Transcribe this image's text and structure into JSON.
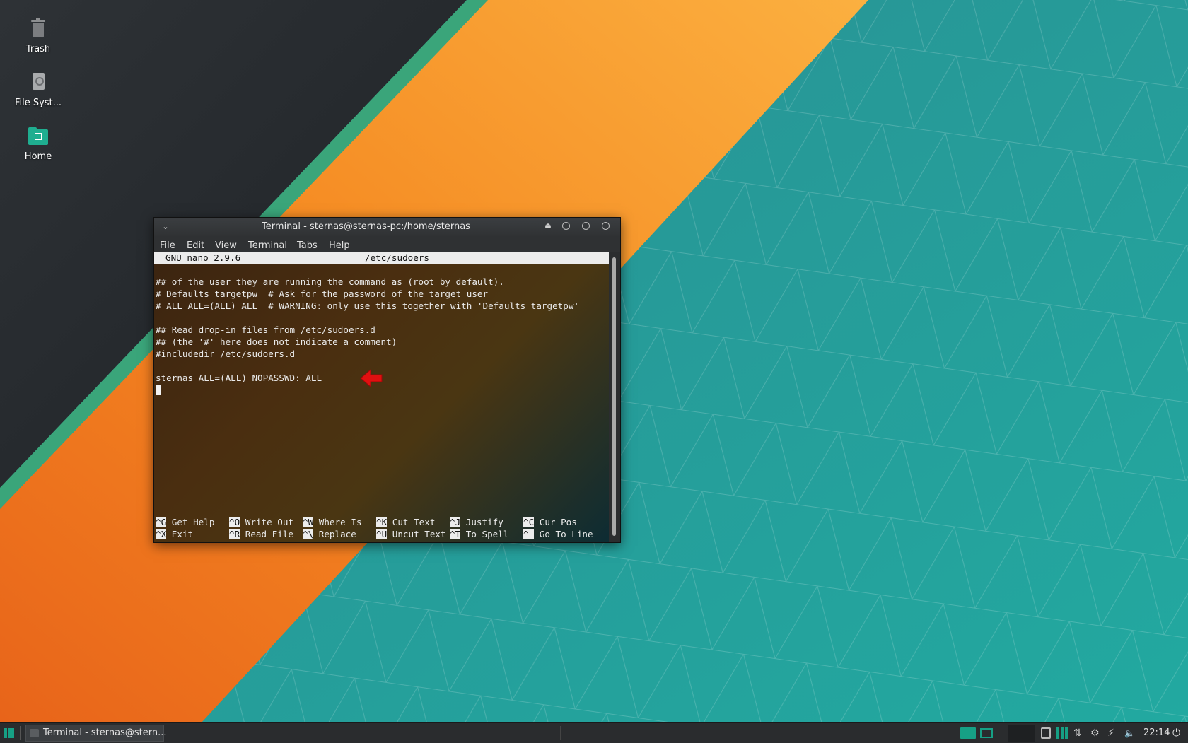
{
  "desktop": {
    "icons": [
      {
        "label": "Trash",
        "icon": "trash-icon"
      },
      {
        "label": "File Syst...",
        "icon": "drive-icon"
      },
      {
        "label": "Home",
        "icon": "home-folder-icon"
      }
    ]
  },
  "window": {
    "title": "Terminal - sternas@sternas-pc:/home/sternas",
    "menu": [
      "File",
      "Edit",
      "View",
      "Terminal",
      "Tabs",
      "Help"
    ]
  },
  "nano": {
    "version": "GNU nano 2.9.6",
    "filename": "/etc/sudoers",
    "lines": [
      "## of the user they are running the command as (root by default).",
      "# Defaults targetpw  # Ask for the password of the target user",
      "# ALL ALL=(ALL) ALL  # WARNING: only use this together with 'Defaults targetpw'",
      "",
      "## Read drop-in files from /etc/sudoers.d",
      "## (the '#' here does not indicate a comment)",
      "#includedir /etc/sudoers.d",
      "",
      "sternas ALL=(ALL) NOPASSWD: ALL"
    ],
    "shortcuts_row1": [
      {
        "key": "^G",
        "label": "Get Help"
      },
      {
        "key": "^O",
        "label": "Write Out"
      },
      {
        "key": "^W",
        "label": "Where Is"
      },
      {
        "key": "^K",
        "label": "Cut Text"
      },
      {
        "key": "^J",
        "label": "Justify"
      },
      {
        "key": "^C",
        "label": "Cur Pos"
      }
    ],
    "shortcuts_row2": [
      {
        "key": "^X",
        "label": "Exit"
      },
      {
        "key": "^R",
        "label": "Read File"
      },
      {
        "key": "^\\",
        "label": "Replace"
      },
      {
        "key": "^U",
        "label": "Uncut Text"
      },
      {
        "key": "^T",
        "label": "To Spell"
      },
      {
        "key": "^_",
        "label": "Go To Line"
      }
    ]
  },
  "annotation": {
    "arrow_color": "#e01010"
  },
  "taskbar": {
    "task_label": "Terminal - sternas@stern...",
    "clock": "22:14"
  },
  "colors": {
    "accent_teal": "#16a085",
    "wallpaper_orange": "#f07a1e",
    "wallpaper_teal": "#2a9a9a"
  }
}
